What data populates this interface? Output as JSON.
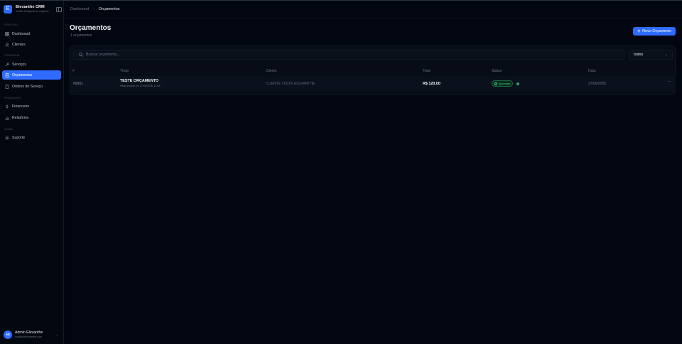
{
  "app": {
    "name": "Elevanthe CRM",
    "subtitle": "Gestão inteligente de negócios",
    "logo_letter": "E"
  },
  "sidebar": {
    "sections": [
      {
        "label": "Principal",
        "items": [
          {
            "label": "Dashboard",
            "icon": "dashboard-icon"
          },
          {
            "label": "Clientes",
            "icon": "users-icon"
          }
        ]
      },
      {
        "label": "Comercial",
        "items": [
          {
            "label": "Serviços",
            "icon": "wrench-icon"
          },
          {
            "label": "Orçamentos",
            "icon": "document-icon",
            "active": true
          },
          {
            "label": "Ordens de Serviço",
            "icon": "clipboard-icon"
          }
        ]
      },
      {
        "label": "Financeiro",
        "items": [
          {
            "label": "Financeiro",
            "icon": "dollar-icon"
          },
          {
            "label": "Relatórios",
            "icon": "chart-icon"
          }
        ]
      },
      {
        "label": "Ajuda",
        "items": [
          {
            "label": "Suporte",
            "icon": "gear-icon"
          }
        ]
      }
    ]
  },
  "user": {
    "initials": "AE",
    "name": "Admin Elevanthe",
    "email": "contato@elevanthe.com"
  },
  "breadcrumb": {
    "parent": "Dashboard",
    "separator": "›",
    "current": "Orçamentos"
  },
  "page": {
    "title": "Orçamentos",
    "count_label": "1 orçamentos",
    "new_button_label": "Novo Orçamento",
    "new_button_icon": "plus-icon"
  },
  "search": {
    "placeholder": "Buscar orçamento...",
    "value": ""
  },
  "filter": {
    "selected": "todos"
  },
  "table": {
    "columns": [
      "#",
      "Título",
      "Cliente",
      "Total",
      "Status",
      "Data"
    ],
    "rows": [
      {
        "id": "#0001",
        "title": "TESTE ORÇAMENTO",
        "responsible": "Responsável em 27/06/2026, 11:55",
        "client": "CLIENTE TESTE ELEVANTHE",
        "total": "R$ 120,00",
        "status": "Aprovado",
        "date": "27/06/2026",
        "menu": "···"
      }
    ]
  },
  "colors": {
    "accent": "#2f6bff",
    "background": "#020610",
    "status_approved": "#3ddc84"
  }
}
